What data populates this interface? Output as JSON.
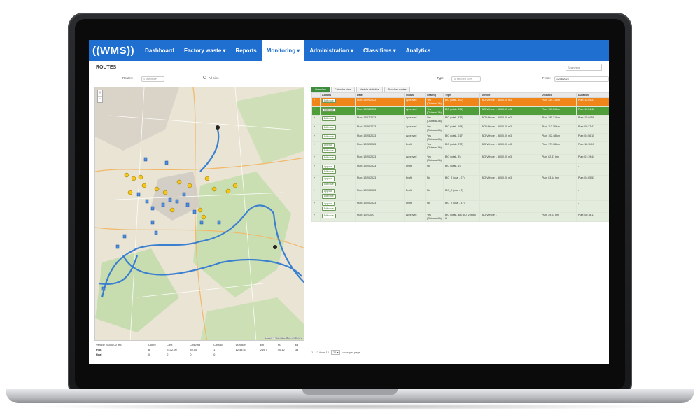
{
  "nav": {
    "logo": "((WMS))",
    "items": [
      {
        "label": "Dashboard"
      },
      {
        "label": "Factory waste ▾"
      },
      {
        "label": "Reports"
      },
      {
        "label": "Monitoring ▾"
      },
      {
        "label": "Administration ▾"
      },
      {
        "label": "Classifiers ▾"
      },
      {
        "label": "Analytics"
      }
    ]
  },
  "page": {
    "title": "ROUTES",
    "search_placeholder": "Searching"
  },
  "filters": {
    "routes_label": "Routes:",
    "routes_value": "4 selected ▾",
    "all_bins": "All bins",
    "type_label": "Type:",
    "type_value": "All selected (6) ▾",
    "from_label": "From:",
    "from_value": "12/06/2023"
  },
  "tabs": [
    "Overview",
    "Calendar view",
    "Vehicle statistics",
    "Standard routes"
  ],
  "table": {
    "headers": [
      "",
      "Actions",
      "Date",
      "Status",
      "Sealing",
      "Type",
      "Vehicle",
      "Distance",
      "Duration"
    ],
    "rows": [
      {
        "style": "orange",
        "buttons": [
          "Edit route"
        ],
        "date": "Plan: 12/29/2023",
        "status": "Approved",
        "sealing": "Yes (Ostrava-Jih)",
        "type": "BIO (total - 100)",
        "vehicle": "BIO Vehicle 1 (6000.00 m3)",
        "distance": "Plan: 249.71 km",
        "duration": "Plan: 12:04:31"
      },
      {
        "style": "green",
        "buttons": [
          "Edit route"
        ],
        "date": "Plan: 12/28/2023",
        "status": "Approved",
        "sealing": "Yes (Ostrava-Jih)",
        "type": "BIO (total - 201)",
        "vehicle": "BIO Vehicle 1 (6000.00 m3)",
        "distance": "Plan: 103.29 km",
        "duration": "Plan: 10:54:46"
      },
      {
        "style": "",
        "buttons": [
          "Edit route"
        ],
        "date": "Plan: 12/27/2023",
        "status": "Approved",
        "sealing": "Yes (Ostrava-Jih)",
        "type": "BIO (total - 433)",
        "vehicle": "BIO Vehicle 1 (6000.00 m3)",
        "distance": "Plan: 185.31 km",
        "duration": "Plan: 11:44:59"
      },
      {
        "style": "",
        "buttons": [
          "Edit route"
        ],
        "date": "Plan: 12/26/2023",
        "status": "Approved",
        "sealing": "Yes (Ostrava-Jih)",
        "type": "BIO (total - 194)",
        "vehicle": "BIO Vehicle 1 (6000.00 m3)",
        "distance": "Plan: 113.39 km",
        "duration": "Plan: 08:37:47"
      },
      {
        "style": "",
        "buttons": [
          "Edit route"
        ],
        "date": "Plan: 12/25/2023",
        "status": "Approved",
        "sealing": "Yes (Ostrava-Jih)",
        "type": "BIO (total - 217)",
        "vehicle": "BIO Vehicle 1 (6000.00 m3)",
        "distance": "Plan: 102.48 km",
        "duration": "Plan: 04:56:15"
      },
      {
        "style": "",
        "buttons": [
          "Approve",
          "Edit route"
        ],
        "date": "Plan: 12/22/2023",
        "status": "Draft",
        "sealing": "Yes (Ostrava-Jih)",
        "type": "BIO (total - 272)",
        "vehicle": "BIO Vehicle 1 (6000.00 m3)",
        "distance": "Plan: 177.38 km",
        "duration": "Plan: 12:11:13"
      },
      {
        "style": "",
        "buttons": [
          "Edit route"
        ],
        "date": "Plan: 12/20/2023",
        "status": "Approved",
        "sealing": "Yes (Ostrava-Jih)",
        "type": "BIO (total - 8)",
        "vehicle": "BIO Vehicle 1 (6000.00 m3)",
        "distance": "Plan: 62.87 km",
        "duration": "Plan: 01:19:44"
      },
      {
        "style": "",
        "buttons": [
          "Approve",
          "Edit route"
        ],
        "date": "Plan: 12/20/2023",
        "status": "Draft",
        "sealing": "No",
        "type": "BIO (total - 6)",
        "vehicle": "-",
        "distance": "-",
        "duration": "-"
      },
      {
        "style": "",
        "buttons": [
          "Approve",
          "Edit route"
        ],
        "date": "Plan: 12/20/2023",
        "status": "Draft",
        "sealing": "No",
        "type": "BIO_2 (total - 27)",
        "vehicle": "BIO Vehicle 1 (6000.00 m3)",
        "distance": "Plan: 63.14 km",
        "duration": "Plan: 04:05:53"
      },
      {
        "style": "",
        "buttons": [
          "Approve",
          "Edit route"
        ],
        "date": "Plan: 12/20/2023",
        "status": "Draft",
        "sealing": "No",
        "type": "BIO_2 (total - 2)",
        "vehicle": "-",
        "distance": "-",
        "duration": "-"
      },
      {
        "style": "",
        "buttons": [
          "Approve",
          "Edit route"
        ],
        "date": "Plan: 12/20/2023",
        "status": "Draft",
        "sealing": "No",
        "type": "BIO_2 (total - 37)",
        "vehicle": "-",
        "distance": "-",
        "duration": "-"
      },
      {
        "style": "",
        "buttons": [
          "Edit route"
        ],
        "date": "Plan: 12/7/2023",
        "status": "Approved",
        "sealing": "Yes (Ostrava-Jih)",
        "type": "BIO (total - 48) BIO_2 (total - 6)",
        "vehicle": "BIO Vehicle 1",
        "distance": "Plan: 29.03 km",
        "duration": "Plan: 08:18:17"
      }
    ]
  },
  "pager": {
    "range": "1 - 12 from 12",
    "per_page": "25 ▾",
    "per_page_label": "rows per page"
  },
  "summary": {
    "vehicle": "Vehicle (6000.00 m3)",
    "headers": [
      "Count",
      "Cost",
      "Cost/m3",
      "Cost/kg",
      "Duration",
      "km",
      "m3",
      "kg"
    ],
    "plan": [
      "Plan",
      "8",
      "2432.00",
      "39.00",
      "1",
      "12:44:31",
      "249.7",
      "40.12",
      "33"
    ],
    "real": [
      "Real",
      "0",
      "0",
      "0",
      "0",
      "",
      "",
      "",
      ""
    ]
  },
  "map": {
    "attribution": "Leaflet | © OpenStreetMap contributors",
    "zoom_in": "+",
    "zoom_out": "−"
  }
}
